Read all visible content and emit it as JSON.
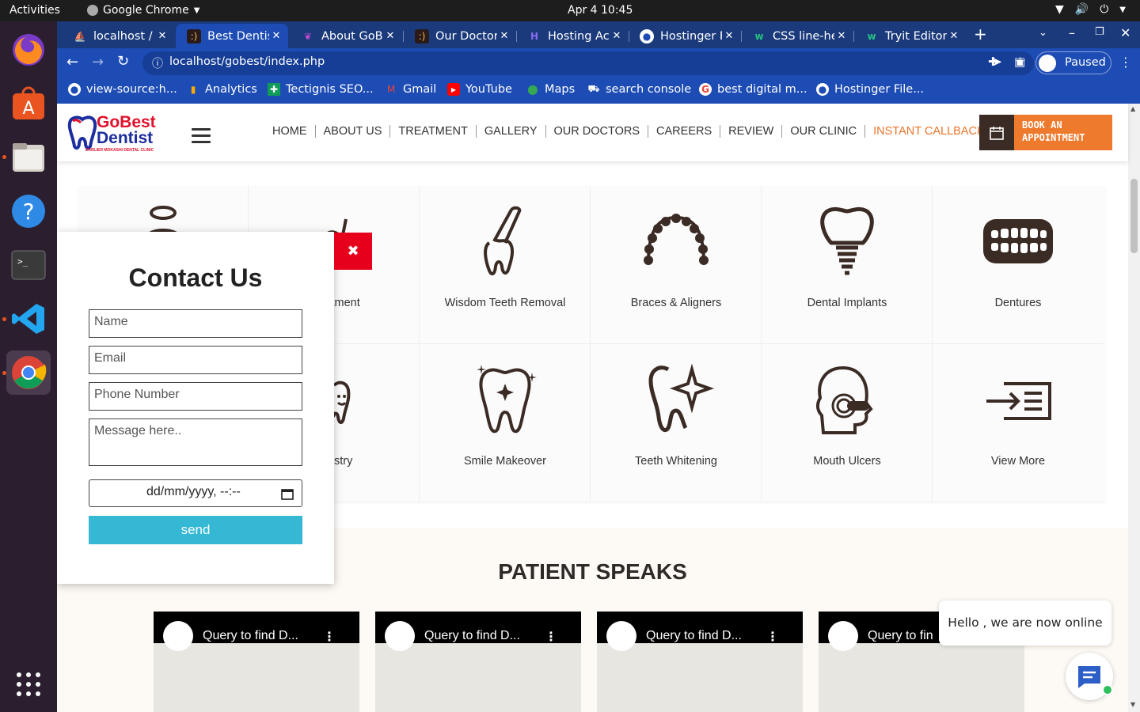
{
  "os": {
    "activities": "Activities",
    "app_name": "Google Chrome",
    "clock": "Apr 4  10:45"
  },
  "tabs": [
    {
      "label": "localhost / l",
      "icon": "phpmyadmin-icon",
      "active": false
    },
    {
      "label": "Best Dentis",
      "icon": "tooth-favicon",
      "active": true
    },
    {
      "label": "About GoB",
      "icon": "tooth-favicon",
      "active": false
    },
    {
      "label": "Our Doctor",
      "icon": "tooth-favicon",
      "active": false
    },
    {
      "label": "Hosting Ac",
      "icon": "hostinger-icon",
      "active": false
    },
    {
      "label": "Hostinger F",
      "icon": "globe-icon",
      "active": false
    },
    {
      "label": "CSS line-hei",
      "icon": "w3schools-icon",
      "active": false
    },
    {
      "label": "Tryit Editor",
      "icon": "w3schools-icon",
      "active": false
    }
  ],
  "toolbar": {
    "url": "localhost/gobest/index.php",
    "profile_label": "Paused"
  },
  "bookmarks": [
    {
      "label": "view-source:h...",
      "icon": "globe-icon"
    },
    {
      "label": "Analytics",
      "icon": "analytics-icon"
    },
    {
      "label": "Tectignis SEO...",
      "icon": "sheets-icon"
    },
    {
      "label": "Gmail",
      "icon": "gmail-icon"
    },
    {
      "label": "YouTube",
      "icon": "youtube-icon"
    },
    {
      "label": "Maps",
      "icon": "maps-icon"
    },
    {
      "label": "search console",
      "icon": "search-console-icon"
    },
    {
      "label": "best digital m...",
      "icon": "google-icon"
    },
    {
      "label": "Hostinger File...",
      "icon": "globe-icon"
    }
  ],
  "site": {
    "logo_top": "GoBest",
    "logo_bottom": "Dentist",
    "logo_tag": "EARLIER MOKASHI DENTAL CLINIC",
    "nav": [
      "HOME",
      "ABOUT US",
      "TREATMENT",
      "GALLERY",
      "OUR DOCTORS",
      "CAREERS",
      "REVIEW",
      "OUR CLINIC",
      "INSTANT CALLBACK"
    ],
    "book_line1": "BOOK AN",
    "book_line2": "APPOINTMENT",
    "accent": "#ee7a2d"
  },
  "services": [
    {
      "label": "",
      "icon": "tooth-halo-icon"
    },
    {
      "label": "Treatment",
      "icon": "root-canal-icon"
    },
    {
      "label": "Wisdom Teeth Removal",
      "icon": "tooth-extraction-icon"
    },
    {
      "label": "Braces & Aligners",
      "icon": "braces-icon"
    },
    {
      "label": "Dental Implants",
      "icon": "dental-implant-icon"
    },
    {
      "label": "Dentures",
      "icon": "dentures-icon"
    },
    {
      "label": "",
      "icon": "blank"
    },
    {
      "label": "entistry",
      "icon": "happy-tooth-icon"
    },
    {
      "label": "Smile Makeover",
      "icon": "sparkle-tooth-icon"
    },
    {
      "label": "Teeth Whitening",
      "icon": "whitening-tooth-icon"
    },
    {
      "label": "Mouth Ulcers",
      "icon": "mouth-ulcer-icon"
    },
    {
      "label": "View More",
      "icon": "view-more-icon"
    }
  ],
  "patient_speaks": {
    "heading": "PATIENT SPEAKS",
    "videos": [
      "Query to find D...",
      "Query to find D...",
      "Query to find D...",
      "Query to fin"
    ]
  },
  "contact_modal": {
    "title": "Contact Us",
    "name_placeholder": "Name",
    "email_placeholder": "Email",
    "phone_placeholder": "Phone Number",
    "message_placeholder": "Message here..",
    "datetime_placeholder": "dd/mm/yyyy, --:--",
    "send_label": "send"
  },
  "chat": {
    "bubble_text": "Hello , we are now online"
  }
}
